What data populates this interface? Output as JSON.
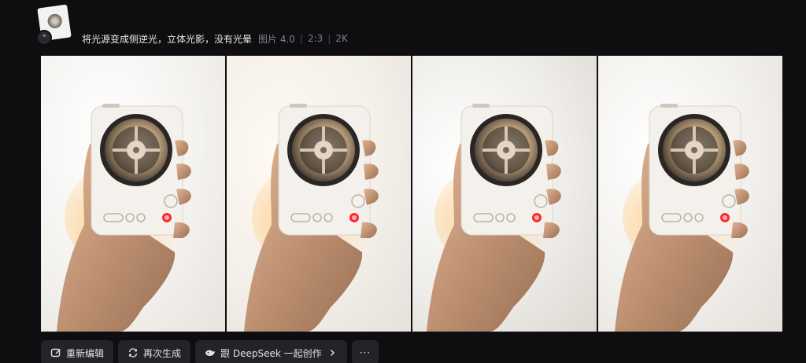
{
  "prompt": {
    "text": "将光源变成侧逆光，立体光影，没有光晕",
    "model": "图片 4.0",
    "ratio": "2:3",
    "resolution": "2K"
  },
  "avatar_badge": "❝",
  "images": [
    {
      "name": "generated-image-1",
      "icon": "hand-holding-music-player"
    },
    {
      "name": "generated-image-2",
      "icon": "hand-holding-music-player"
    },
    {
      "name": "generated-image-3",
      "icon": "hand-holding-music-player"
    },
    {
      "name": "generated-image-4",
      "icon": "hand-holding-music-player"
    }
  ],
  "actions": {
    "reedit": "重新编辑",
    "regenerate": "再次生成",
    "deepseek": "跟 DeepSeek 一起创作",
    "more": "···"
  },
  "colors": {
    "background": "#0e0e10",
    "button_bg": "#232428",
    "meta_text": "#7d8089",
    "record_red": "#ff2a2a"
  }
}
